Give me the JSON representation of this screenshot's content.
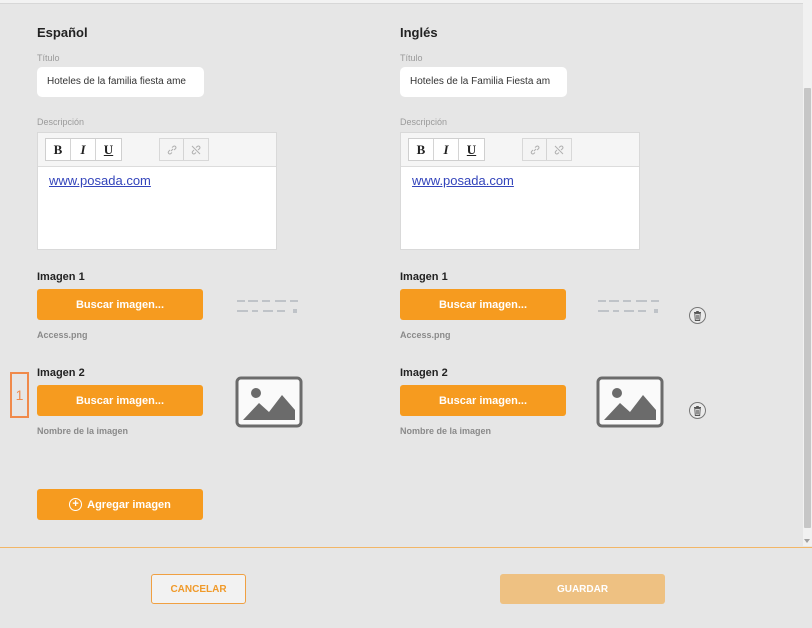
{
  "spanish": {
    "heading": "Español",
    "title_label": "Título",
    "title_value": "Hoteles de la familia fiesta ame",
    "description_label": "Descripción",
    "editor": {
      "bold": "B",
      "italic": "I",
      "underline": "U",
      "link_text": "www.posada.com"
    },
    "images": [
      {
        "label": "Imagen 1",
        "button": "Buscar imagen...",
        "file_name": "Access.png"
      },
      {
        "label": "Imagen 2",
        "button": "Buscar imagen...",
        "file_name": "Nombre de la imagen"
      }
    ]
  },
  "english": {
    "heading": "Inglés",
    "title_label": "Título",
    "title_value": "Hoteles de la Familia Fiesta am",
    "description_label": "Descripción",
    "editor": {
      "bold": "B",
      "italic": "I",
      "underline": "U",
      "link_text": "www.posada.com"
    },
    "images": [
      {
        "label": "Imagen 1",
        "button": "Buscar imagen...",
        "file_name": "Access.png"
      },
      {
        "label": "Imagen 2",
        "button": "Buscar imagen...",
        "file_name": "Nombre de la imagen"
      }
    ]
  },
  "add_image_label": "Agregar imagen",
  "marker_label": "1",
  "footer": {
    "cancel": "CANCELAR",
    "save": "GUARDAR"
  },
  "icons": {
    "link": "link-icon",
    "unlink": "unlink-icon",
    "trash": "trash-icon",
    "image_placeholder": "image-placeholder-icon",
    "plus": "plus-circle-icon"
  },
  "colors": {
    "accent": "#f69b1f",
    "save_disabled": "#eec182",
    "link": "#3344bb",
    "marker": "#f08a4b"
  }
}
